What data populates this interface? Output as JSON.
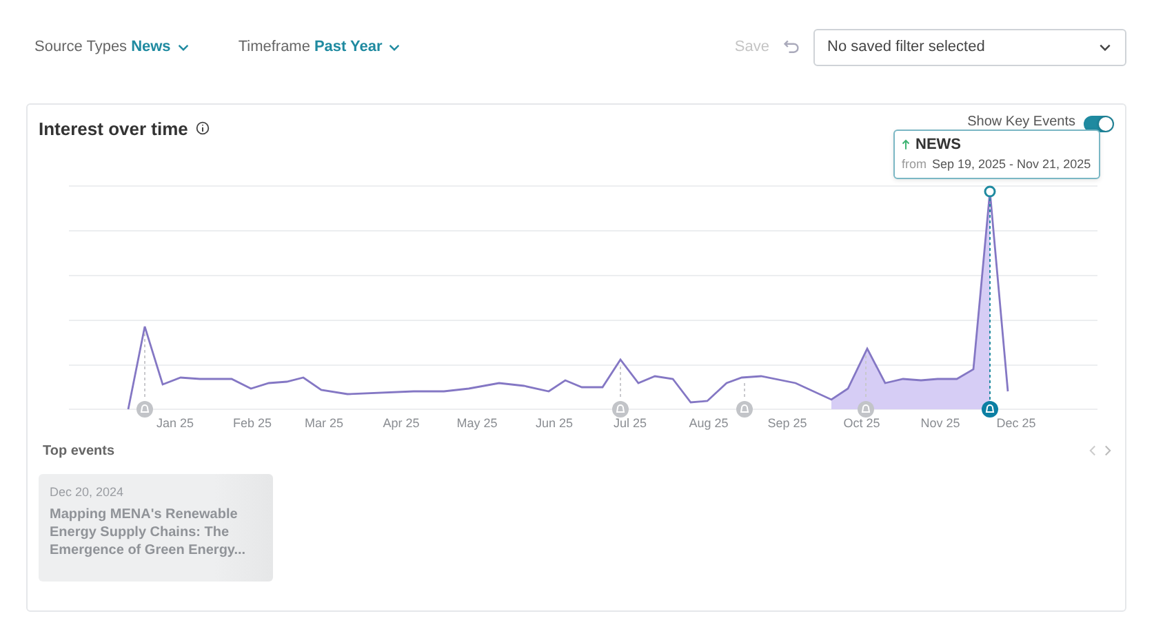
{
  "filters": [
    {
      "label": "Source Types",
      "value": "News"
    },
    {
      "label": "Timeframe",
      "value": "Past Year"
    }
  ],
  "save": {
    "label": "Save",
    "disabled": true
  },
  "saved_filter": {
    "value": "No saved filter selected"
  },
  "panel": {
    "title": "Interest over time",
    "show_key_events": {
      "label": "Show Key Events",
      "on": true
    },
    "chart": {
      "x_labels": [
        "Jan 25",
        "Feb 25",
        "Mar 25",
        "Apr 25",
        "May 25",
        "Jun 25",
        "Jul 25",
        "Aug 25",
        "Sep 25",
        "Oct 25",
        "Nov 25",
        "Dec 25"
      ],
      "events": [
        {
          "selected": false
        },
        {
          "selected": false
        },
        {
          "selected": false
        },
        {
          "selected": false
        },
        {
          "selected": true
        }
      ],
      "tooltip": {
        "title": "NEWS",
        "from_label": "from",
        "range": "Sep 19, 2025 - Nov 21, 2025"
      }
    }
  },
  "top_events": {
    "title": "Top events",
    "items": [
      {
        "date": "Dec 20, 2024",
        "title": "Mapping MENA's Renewable Energy Supply Chains: The Emergence of Green Energy..."
      }
    ]
  }
}
